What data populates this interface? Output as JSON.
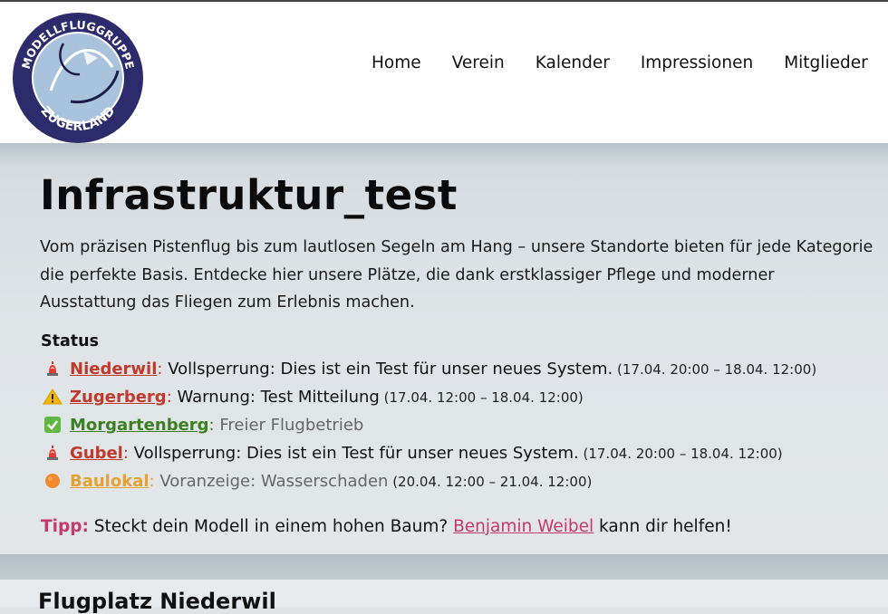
{
  "header": {
    "logo": {
      "top_text": "MODELLFLUGGRUPPE",
      "bottom_text": "ZUGERLAND"
    },
    "nav": [
      {
        "label": "Home"
      },
      {
        "label": "Verein"
      },
      {
        "label": "Kalender"
      },
      {
        "label": "Impressionen"
      },
      {
        "label": "Mitglieder"
      }
    ]
  },
  "main": {
    "title": "Infrastruktur_test",
    "intro": "Vom präzisen Pistenflug bis zum lautlosen Segeln am Hang – unsere Standorte bieten für jede Kategorie die perfekte Basis. Entdecke hier unsere Plätze, die dank erstklassiger Pflege und moderner Ausstattung das Fliegen zum Erlebnis machen.",
    "status_title": "Status",
    "status": [
      {
        "icon": "siren-icon",
        "location": "Niederwil",
        "colon": ":",
        "message": " Vollsperrung: Dies ist ein Test für unser neues System.",
        "time": " (17.04. 20:00 – 18.04. 12:00)"
      },
      {
        "icon": "warning-icon",
        "location": "Zugerberg",
        "colon": ":",
        "message": " Warnung: Test Mitteilung",
        "time": " (17.04. 12:00 – 18.04. 12:00)"
      },
      {
        "icon": "check-icon",
        "location": "Morgartenberg",
        "colon": ":",
        "message": " Freier Flugbetrieb",
        "time": ""
      },
      {
        "icon": "siren-icon",
        "location": "Gubel",
        "colon": ":",
        "message": " Vollsperrung: Dies ist ein Test für unser neues System.",
        "time": " (17.04. 20:00 – 18.04. 12:00)"
      },
      {
        "icon": "orange-circle-icon",
        "location": "Baulokal",
        "colon": ":",
        "message": " Voranzeige: Wasserschaden",
        "time": " (20.04. 12:00 – 21.04. 12:00)"
      }
    ],
    "tipp": {
      "label": "Tipp:",
      "text_before": " Steckt dein Modell in einem hohen Baum? ",
      "link": "Benjamin Weibel",
      "text_after": " kann dir helfen!"
    }
  },
  "next_section": {
    "title": "Flugplatz Niederwil"
  },
  "colors": {
    "closed": "#c0392b",
    "open": "#3f7f24",
    "notice": "#e3a232",
    "tipp": "#c7386b",
    "logo_ring": "#2c2b6b",
    "logo_fill": "#a9c3dc"
  }
}
